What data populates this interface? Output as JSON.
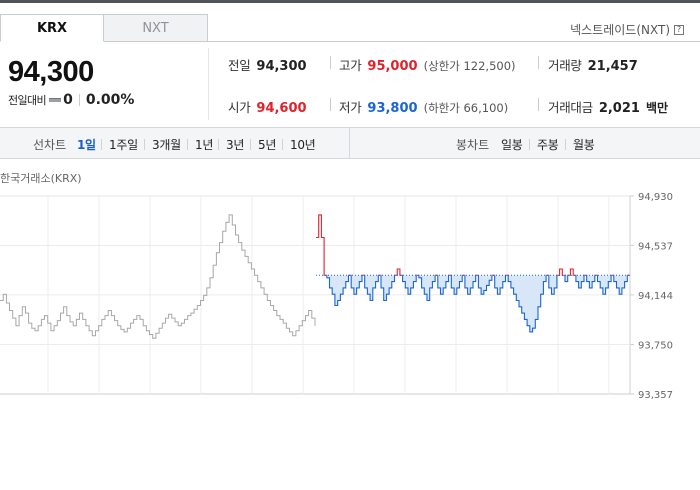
{
  "tabs": [
    {
      "label": "KRX",
      "active": true
    },
    {
      "label": "NXT",
      "active": false
    }
  ],
  "nxt_link": {
    "label": "넥스트레이드(NXT)",
    "help": "?"
  },
  "price": {
    "current": "94,300",
    "change_label": "전일대비",
    "change_value": "0",
    "change_pct": "0.00%"
  },
  "stats": {
    "prev_close": {
      "label": "전일",
      "value": "94,300"
    },
    "high": {
      "label": "고가",
      "value": "95,000",
      "sub": "(상한가 122,500)"
    },
    "volume": {
      "label": "거래량",
      "value": "21,457"
    },
    "open": {
      "label": "시가",
      "value": "94,600"
    },
    "low": {
      "label": "저가",
      "value": "93,800",
      "sub": "(하한가 66,100)"
    },
    "turnover": {
      "label": "거래대금",
      "value": "2,021",
      "unit": "백만"
    }
  },
  "toolbar": {
    "line_label": "선차트",
    "line_periods": [
      "1일",
      "1주일",
      "3개월",
      "1년",
      "3년",
      "5년",
      "10년"
    ],
    "active_period": "1일",
    "candle_label": "봉차트",
    "candle_periods": [
      "일봉",
      "주봉",
      "월봉"
    ]
  },
  "chart_label": "한국거래소(KRX)",
  "colors": {
    "up": "#e3212a",
    "down": "#1a65d6",
    "prev_day_line": "#a8a8a8",
    "accent": "#1a5fc8"
  },
  "chart_data": {
    "type": "line",
    "title": "",
    "ylim": [
      93357,
      94930
    ],
    "y_ticks": [
      94930,
      94537,
      94144,
      93750,
      93357
    ],
    "y_tick_labels": [
      "94,930",
      "94,537",
      "94,144",
      "93,750",
      "93,357"
    ],
    "baseline": 94300,
    "series": [
      {
        "values": [
          94100,
          94150,
          94080,
          94020,
          93960,
          93900,
          93980,
          94050,
          94000,
          93920,
          93880,
          93860,
          93900,
          93950,
          93980,
          93920,
          93860,
          93900,
          93940,
          94000,
          94050,
          93980,
          93930,
          93900,
          93950,
          94000,
          93950,
          93900,
          93860,
          93820,
          93860,
          93900,
          93950,
          93980,
          94020,
          93980,
          93940,
          93900,
          93870,
          93850,
          93880,
          93920,
          93950,
          93980,
          93950,
          93900,
          93860,
          93830,
          93800,
          93840,
          93880,
          93920,
          93960,
          93990,
          93960,
          93930,
          93900,
          93920,
          93950,
          93980,
          94000,
          94030,
          94060,
          94100,
          94140,
          94200,
          94280,
          94380,
          94480,
          94560,
          94650,
          94720,
          94780,
          94700,
          94620,
          94560,
          94500,
          94450,
          94400,
          94350,
          94300,
          94250,
          94200,
          94150,
          94100,
          94060,
          94020,
          93980,
          93950,
          93920,
          93880,
          93850,
          93820,
          93860,
          93900,
          93940,
          93980,
          94020,
          93960,
          93900
        ]
      },
      {
        "values": [
          94600,
          94780,
          94600,
          94300,
          94280,
          94200,
          94150,
          94060,
          94100,
          94150,
          94200,
          94250,
          94300,
          94200,
          94150,
          94200,
          94250,
          94300,
          94200,
          94150,
          94100,
          94200,
          94250,
          94300,
          94200,
          94100,
          94150,
          94200,
          94250,
          94300,
          94350,
          94300,
          94250,
          94200,
          94150,
          94200,
          94250,
          94300,
          94280,
          94200,
          94150,
          94100,
          94200,
          94250,
          94300,
          94200,
          94150,
          94200,
          94250,
          94300,
          94200,
          94150,
          94200,
          94250,
          94300,
          94200,
          94150,
          94200,
          94250,
          94300,
          94200,
          94150,
          94180,
          94220,
          94260,
          94300,
          94200,
          94150,
          94200,
          94250,
          94300,
          94250,
          94200,
          94150,
          94100,
          94050,
          94000,
          93950,
          93900,
          93850,
          93880,
          93950,
          94050,
          94150,
          94250,
          94300,
          94200,
          94150,
          94200,
          94300,
          94350,
          94300,
          94250,
          94300,
          94350,
          94300,
          94250,
          94200,
          94250,
          94300,
          94250,
          94200,
          94250,
          94300,
          94250,
          94200,
          94150,
          94200,
          94250,
          94300,
          94250,
          94200,
          94150,
          94200,
          94250,
          94300,
          94300
        ]
      }
    ]
  }
}
